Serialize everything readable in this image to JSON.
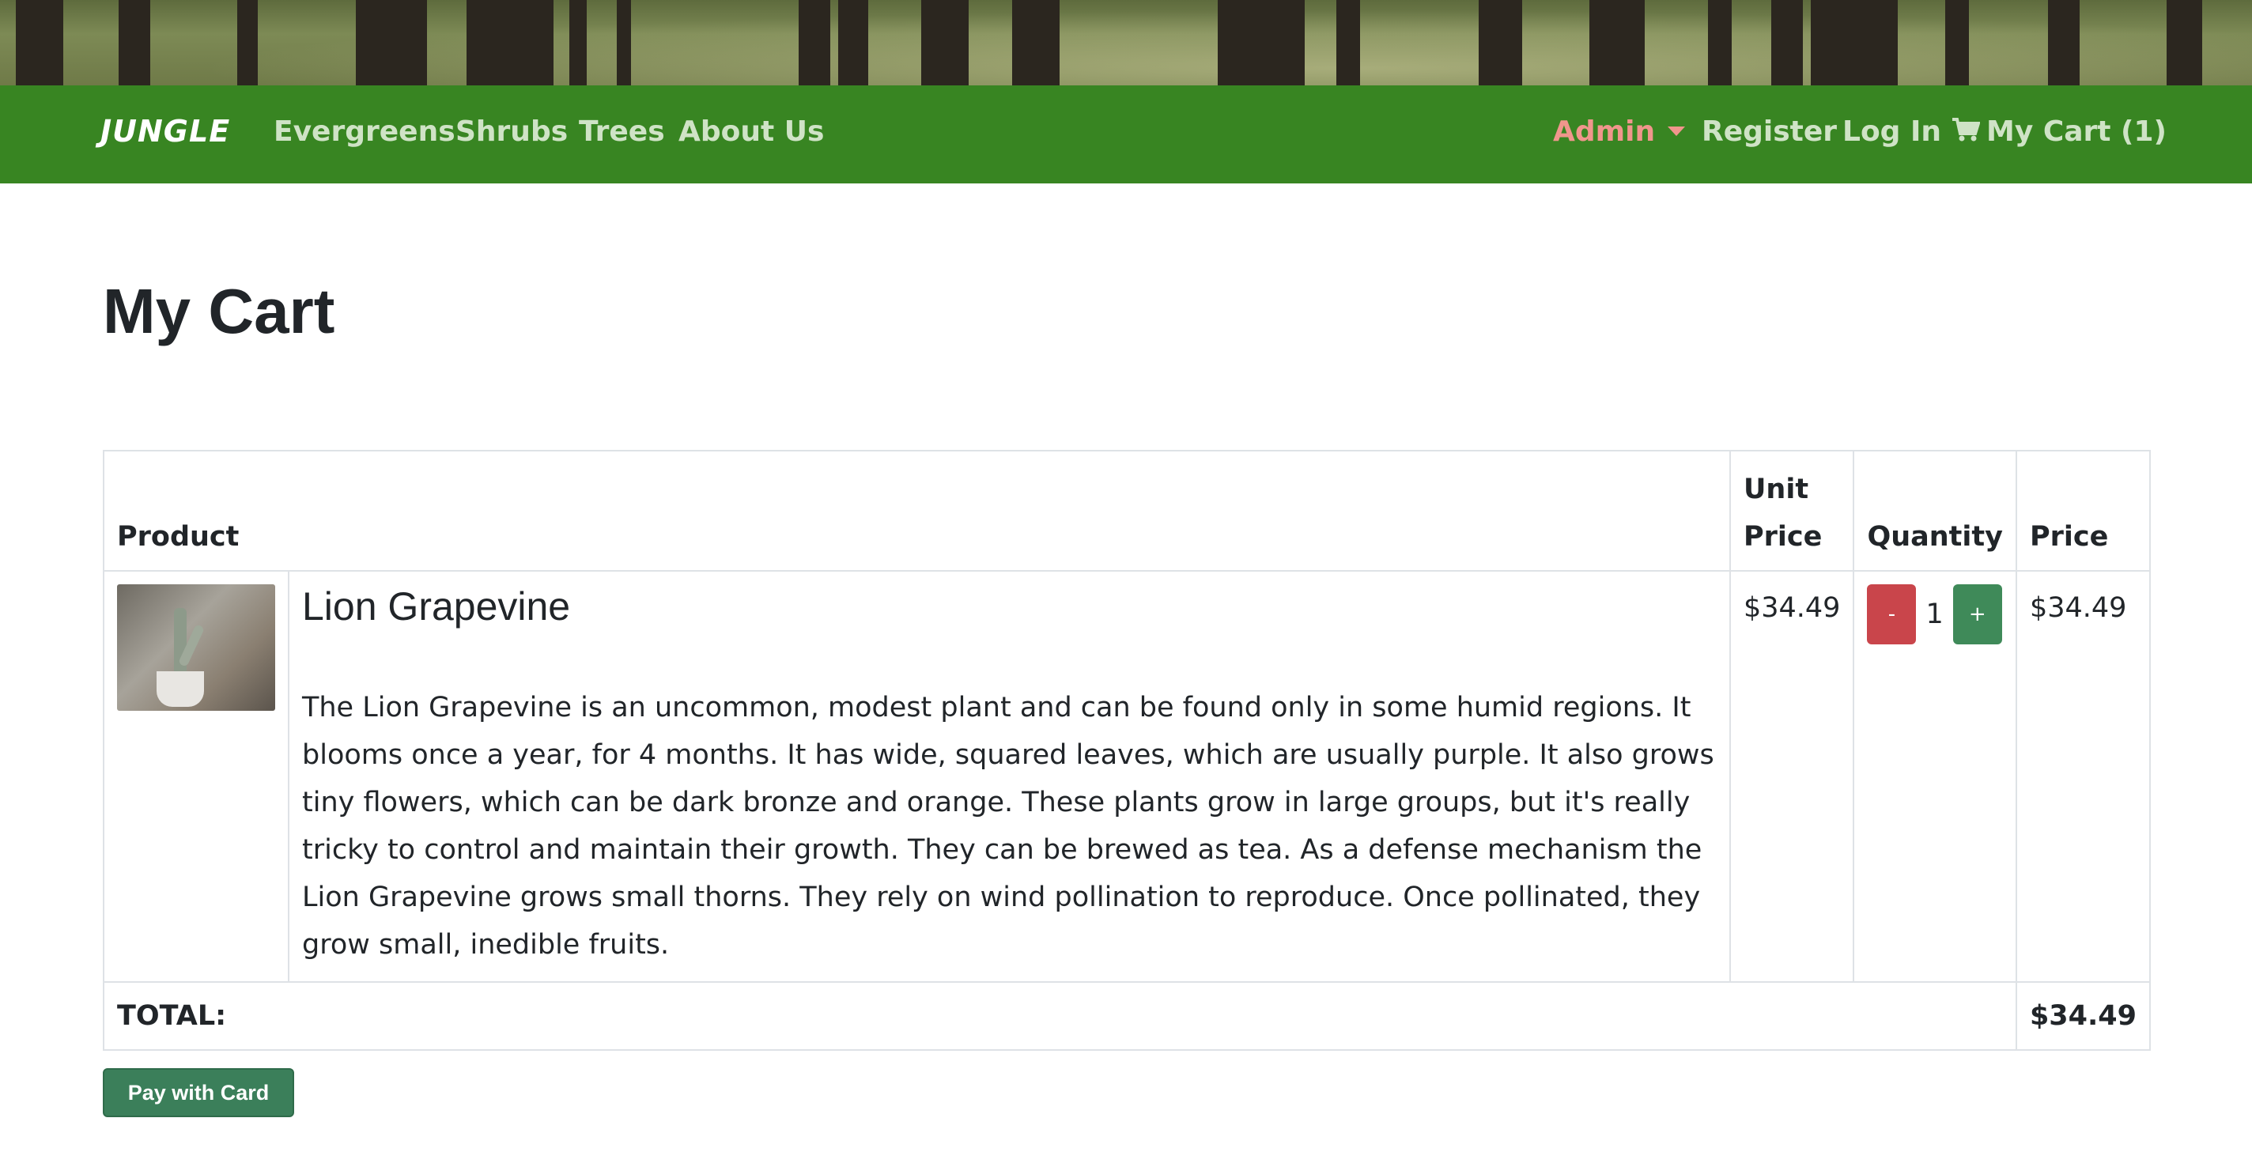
{
  "nav": {
    "brand": "JUNGLE",
    "links": [
      {
        "label": "Evergreens"
      },
      {
        "label": "Shrubs"
      },
      {
        "label": "Trees"
      },
      {
        "label": "About Us"
      }
    ],
    "admin": "Admin",
    "register": "Register",
    "login": "Log In",
    "cart": "My Cart (1)"
  },
  "page": {
    "title": "My Cart"
  },
  "table": {
    "headers": {
      "product": "Product",
      "unit_price": "Unit Price",
      "quantity": "Quantity",
      "price": "Price"
    },
    "items": [
      {
        "name": "Lion Grapevine",
        "description": "The Lion Grapevine is an uncommon, modest plant and can be found only in some humid regions. It blooms once a year, for 4 months. It has wide, squared leaves, which are usually purple. It also grows tiny flowers, which can be dark bronze and orange. These plants grow in large groups, but it's really tricky to control and maintain their growth. They can be brewed as tea. As a defense mechanism the Lion Grapevine grows small thorns. They rely on wind pollination to reproduce. Once pollinated, they grow small, inedible fruits.",
        "unit_price": "$34.49",
        "quantity": "1",
        "minus_label": "-",
        "plus_label": "+",
        "price": "$34.49"
      }
    ],
    "total_label": "TOTAL:",
    "total_value": "$34.49"
  },
  "checkout": {
    "pay_label": "Pay with Card"
  },
  "colors": {
    "navbar": "#388522",
    "nav_link": "#cfe3c6",
    "admin_link": "#f0968c",
    "minus_button": "#c9454b",
    "plus_button": "#3f8a59",
    "pay_button": "#3b7f5a"
  }
}
